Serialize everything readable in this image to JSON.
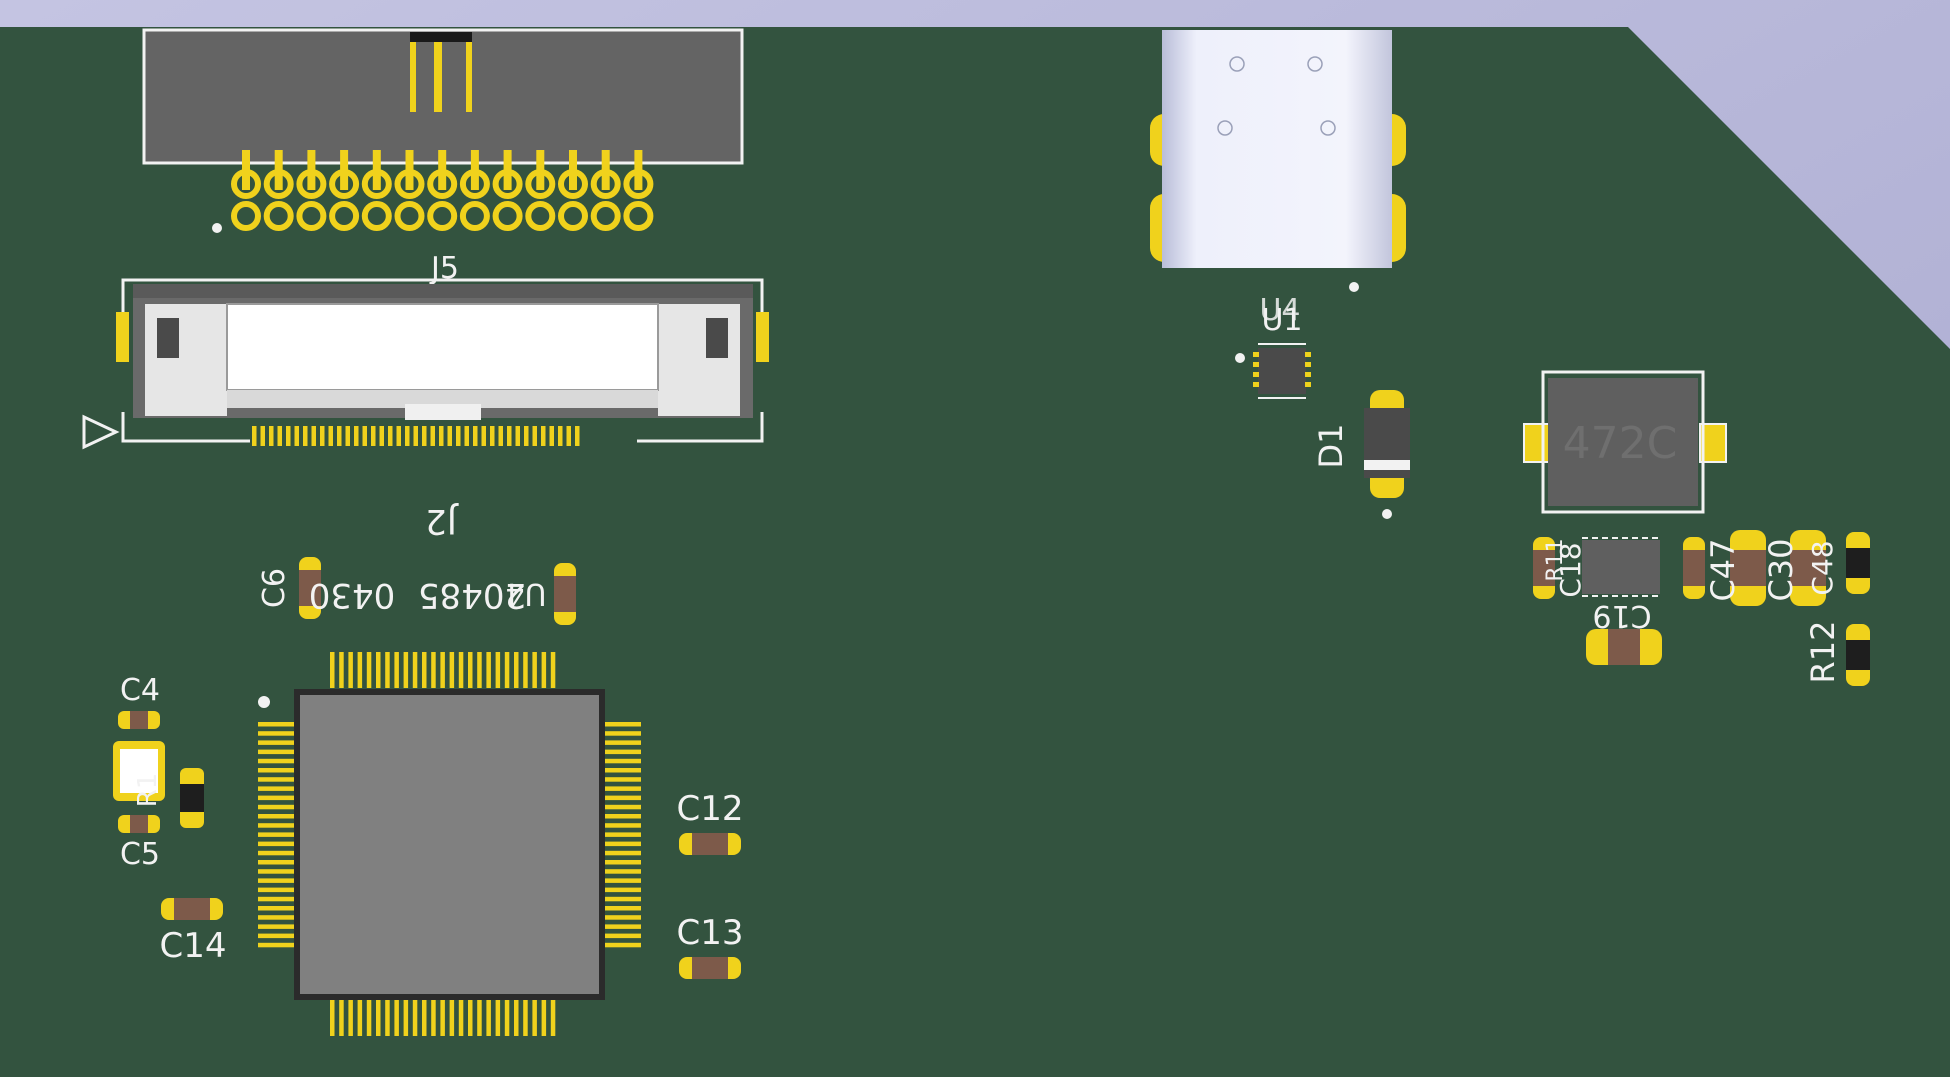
{
  "viewer": {
    "board_color": "#33533f",
    "background_color": "#b8b8d8",
    "pad_color": "#f0d21c",
    "silkscreen_color": "#f2f2f2",
    "body_color": "#808080"
  },
  "designators": {
    "j5": "J5",
    "j2": "J2",
    "c6": "C6",
    "c6_value": "20485",
    "c6_value_tail": "0430",
    "u4": "U4",
    "u1": "U1",
    "d1": "D1",
    "l1_marking": "472C",
    "c4": "C4",
    "c5": "C5",
    "r1": "R1",
    "c12": "C12",
    "c13": "C13",
    "c14": "C14",
    "r12": "R12",
    "c18": "C18",
    "c19": "C19",
    "c47": "C47",
    "c30": "C30",
    "c48": "C48",
    "r11": "R11"
  }
}
